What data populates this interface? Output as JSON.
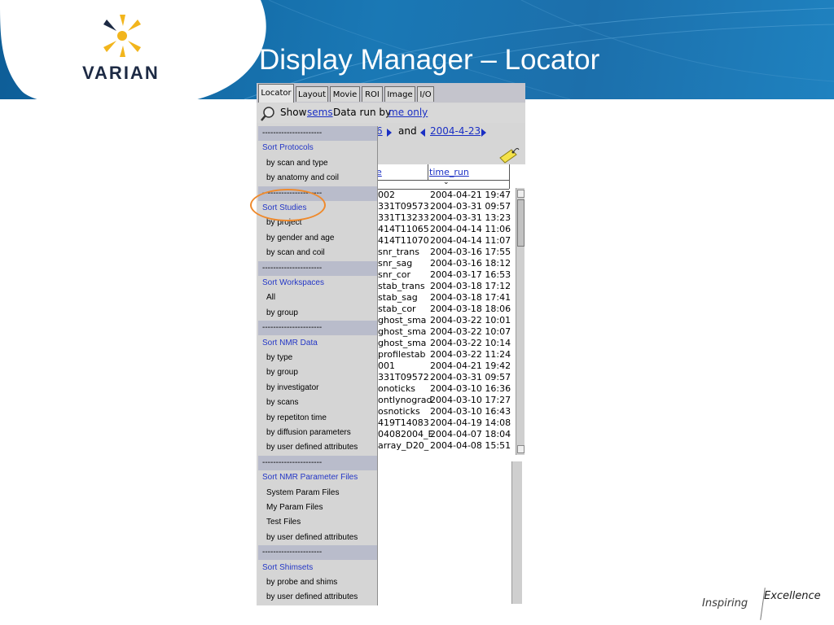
{
  "slide": {
    "title": "Display Manager – Locator",
    "logo_text": "VARIAN",
    "footer_inspiring": "Inspiring",
    "footer_excellence": "Excellence",
    "header_color": "#1a78b5",
    "highlight_color": "#ef8a2c"
  },
  "window": {
    "tabs": [
      {
        "label": "Locator",
        "active": true
      },
      {
        "label": "Layout"
      },
      {
        "label": "Movie"
      },
      {
        "label": "ROI"
      },
      {
        "label": "Image"
      },
      {
        "label": "I/O"
      }
    ],
    "show_label": "Show",
    "show_type": "sems",
    "data_run_by": "Data run by",
    "owner": "me only",
    "date_from_fragment": "6",
    "and_label": "and",
    "date_to": "2004-4-23",
    "columns": [
      "e",
      "time_run"
    ],
    "rows": [
      [
        "002",
        "2004-04-21 19:47"
      ],
      [
        "331T09573",
        "2004-03-31 09:57"
      ],
      [
        "331T13233",
        "2004-03-31 13:23"
      ],
      [
        "414T11065",
        "2004-04-14 11:06"
      ],
      [
        "414T11070",
        "2004-04-14 11:07"
      ],
      [
        "snr_trans",
        "2004-03-16 17:55"
      ],
      [
        "snr_sag",
        "2004-03-16 18:12"
      ],
      [
        "snr_cor",
        "2004-03-17 16:53"
      ],
      [
        "stab_trans",
        "2004-03-18 17:12"
      ],
      [
        "stab_sag",
        "2004-03-18 17:41"
      ],
      [
        "stab_cor",
        "2004-03-18 18:06"
      ],
      [
        "ghost_sma",
        "2004-03-22 10:01"
      ],
      [
        "ghost_sma",
        "2004-03-22 10:07"
      ],
      [
        "ghost_sma",
        "2004-03-22 10:14"
      ],
      [
        "profilestab",
        "2004-03-22 11:24"
      ],
      [
        "001",
        "2004-04-21 19:42"
      ],
      [
        "331T09572",
        "2004-03-31 09:57"
      ],
      [
        "onoticks",
        "2004-03-10 16:36"
      ],
      [
        "ontlynograd",
        "2004-03-10 17:27"
      ],
      [
        "osnoticks",
        "2004-03-10 16:43"
      ],
      [
        "419T14083",
        "2004-04-19 14:08"
      ],
      [
        "04082004_E",
        "2004-04-07 18:04"
      ],
      [
        "array_D20_",
        "2004-04-08 15:51"
      ]
    ],
    "sort_indicator": "⌄"
  },
  "menu": {
    "items": [
      {
        "kind": "sep",
        "label": "----------------------"
      },
      {
        "kind": "hdr",
        "label": "Sort Protocols"
      },
      {
        "kind": "item",
        "label": "by scan and type"
      },
      {
        "kind": "item",
        "label": "by anatomy and coil"
      },
      {
        "kind": "sep",
        "label": "----------------------"
      },
      {
        "kind": "hdr",
        "label": "Sort Studies"
      },
      {
        "kind": "item",
        "label": "by project"
      },
      {
        "kind": "item",
        "label": "by gender and age"
      },
      {
        "kind": "item",
        "label": "by scan and coil"
      },
      {
        "kind": "sep",
        "label": "----------------------"
      },
      {
        "kind": "hdr",
        "label": "Sort Workspaces"
      },
      {
        "kind": "item",
        "label": "All"
      },
      {
        "kind": "item",
        "label": "by group"
      },
      {
        "kind": "sep",
        "label": "----------------------"
      },
      {
        "kind": "hdr",
        "label": "Sort NMR Data"
      },
      {
        "kind": "item",
        "label": "by type"
      },
      {
        "kind": "item",
        "label": "by group"
      },
      {
        "kind": "item",
        "label": "by investigator"
      },
      {
        "kind": "item",
        "label": "by scans"
      },
      {
        "kind": "item",
        "label": "by repetiton time"
      },
      {
        "kind": "item",
        "label": "by diffusion parameters"
      },
      {
        "kind": "item",
        "label": "by user defined attributes"
      },
      {
        "kind": "sep",
        "label": "----------------------"
      },
      {
        "kind": "hdr",
        "label": "Sort NMR Parameter Files"
      },
      {
        "kind": "item",
        "label": "System Param Files"
      },
      {
        "kind": "item",
        "label": "My Param Files"
      },
      {
        "kind": "item",
        "label": "Test Files"
      },
      {
        "kind": "item",
        "label": "by user defined attributes"
      },
      {
        "kind": "sep",
        "label": "----------------------"
      },
      {
        "kind": "hdr",
        "label": "Sort Shimsets"
      },
      {
        "kind": "item",
        "label": "by probe and shims"
      },
      {
        "kind": "item",
        "label": "by user defined attributes"
      }
    ]
  }
}
